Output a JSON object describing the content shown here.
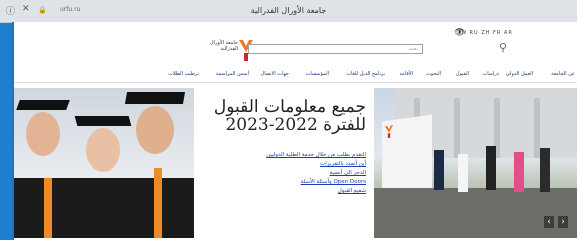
{
  "browser": {
    "tab_title": "جامعة الأورال الفدرالية",
    "url": "urfu.ru",
    "icons": [
      "info-icon",
      "close-icon",
      "lock-icon"
    ]
  },
  "header": {
    "logo_text": "جامعة الأورال الفدرالية",
    "search_placeholder": "بحث",
    "languages": "EN RU ZH FR AR",
    "nav": [
      "عن الجامعة",
      "العمل الدولي",
      "دراسات",
      "القبول",
      "البحوث",
      "الأقامة",
      "برنامج الدبل للغات",
      "المؤسسات",
      "جهات الاتصال",
      "أسس المراسمة",
      "ترطيب الطلاب"
    ]
  },
  "hero": {
    "title_line1": "جميع معلومات القبول",
    "title_line2": "للفترة 2022-2023",
    "links": [
      "التقدم بطلب من خلال خدمة الطلبة الدوليين",
      "أين أتمدد بالتقريرات",
      "الدجر الى أنسية",
      "وأسئلة الأسلة Open Doors",
      "شفيع القبول"
    ],
    "prev": "‹",
    "next": "›"
  },
  "colors": {
    "frame_blue": "#1e7fd0",
    "logo_orange": "#f0781e",
    "logo_red": "#d8232a",
    "link_blue": "#1a3fb0"
  }
}
